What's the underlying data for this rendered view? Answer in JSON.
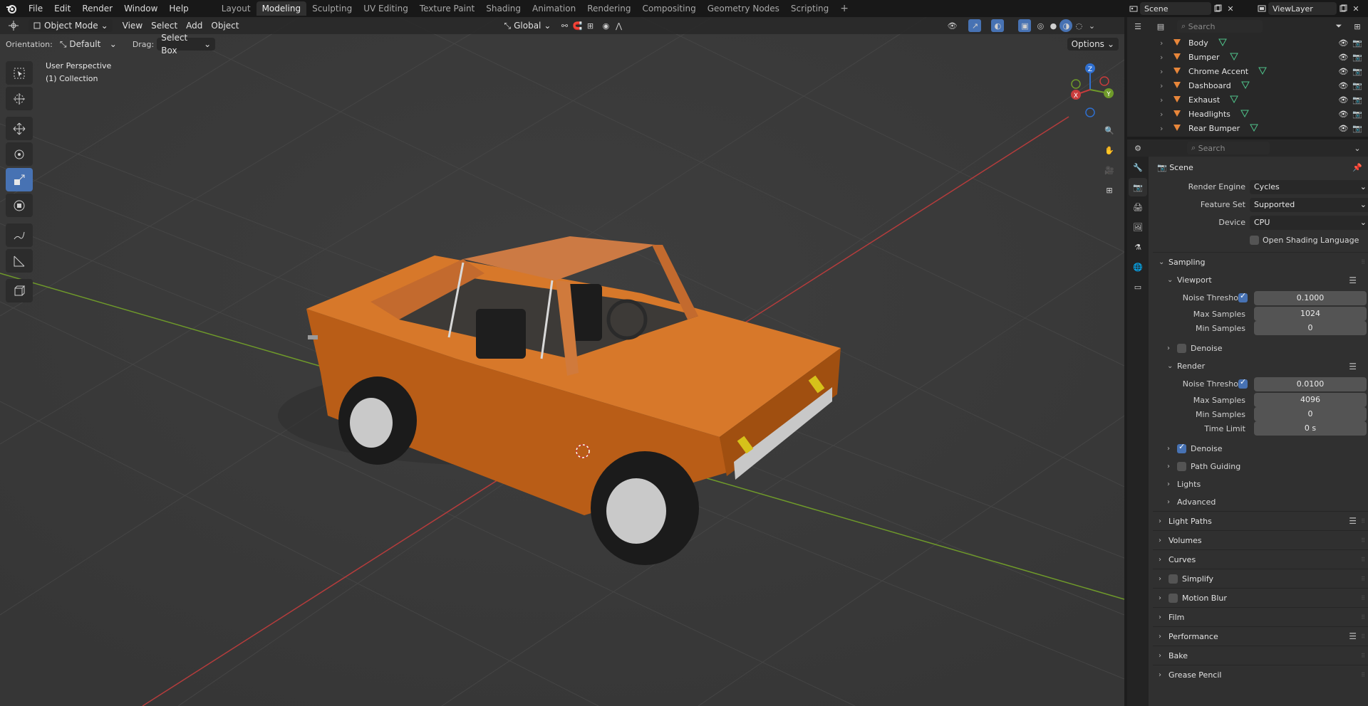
{
  "menu": [
    "File",
    "Edit",
    "Render",
    "Window",
    "Help"
  ],
  "workspaces": [
    {
      "label": "Layout",
      "active": false
    },
    {
      "label": "Modeling",
      "active": true
    },
    {
      "label": "Sculpting",
      "active": false
    },
    {
      "label": "UV Editing",
      "active": false
    },
    {
      "label": "Texture Paint",
      "active": false
    },
    {
      "label": "Shading",
      "active": false
    },
    {
      "label": "Animation",
      "active": false
    },
    {
      "label": "Rendering",
      "active": false
    },
    {
      "label": "Compositing",
      "active": false
    },
    {
      "label": "Geometry Nodes",
      "active": false
    },
    {
      "label": "Scripting",
      "active": false
    }
  ],
  "topbar": {
    "scene": "Scene",
    "view_layer": "ViewLayer",
    "add_workspace": "+"
  },
  "viewport": {
    "mode": "Object Mode",
    "menus": [
      "View",
      "Select",
      "Add",
      "Object"
    ],
    "transform": "Global",
    "orientation_label": "Orientation:",
    "orientation_value": "Default",
    "drag_label": "Drag:",
    "drag_value": "Select Box",
    "options": "Options",
    "info_line1": "User Perspective",
    "info_line2": "(1) Collection",
    "gizmo": {
      "x": "X",
      "y": "Y",
      "z": "Z"
    },
    "colors": {
      "x_axis": "#b53c3c",
      "y_axis": "#6f9a2a",
      "car_body": "#c9691c"
    }
  },
  "outliner": {
    "search_placeholder": "Search",
    "items": [
      "Body",
      "Bumper",
      "Chrome Accent",
      "Dashboard",
      "Exhaust",
      "Headlights",
      "Rear Bumper"
    ]
  },
  "properties": {
    "search_placeholder": "Search",
    "context": "Scene",
    "render_engine": {
      "label": "Render Engine",
      "value": "Cycles"
    },
    "feature_set": {
      "label": "Feature Set",
      "value": "Supported"
    },
    "device": {
      "label": "Device",
      "value": "CPU"
    },
    "osl": {
      "label": "Open Shading Language",
      "checked": false
    },
    "sampling": {
      "title": "Sampling",
      "viewport": {
        "title": "Viewport",
        "noise_threshold_label": "Noise Threshold",
        "noise_threshold": "0.1000",
        "max_samples_label": "Max Samples",
        "max_samples": "1024",
        "min_samples_label": "Min Samples",
        "min_samples": "0",
        "denoise": "Denoise"
      },
      "render": {
        "title": "Render",
        "noise_threshold_label": "Noise Threshold",
        "noise_threshold": "0.0100",
        "max_samples_label": "Max Samples",
        "max_samples": "4096",
        "min_samples_label": "Min Samples",
        "min_samples": "0",
        "time_limit_label": "Time Limit",
        "time_limit": "0 s"
      },
      "denoise": "Denoise",
      "path_guiding": "Path Guiding",
      "lights": "Lights",
      "advanced": "Advanced"
    },
    "sections": [
      "Light Paths",
      "Volumes",
      "Curves",
      "Simplify",
      "Motion Blur",
      "Film",
      "Performance",
      "Bake",
      "Grease Pencil"
    ]
  }
}
